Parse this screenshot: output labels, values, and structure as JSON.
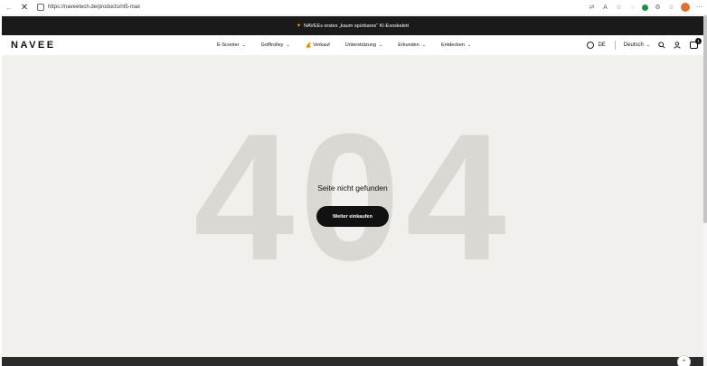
{
  "browser": {
    "url": "https://naveetech.de/products/nt5-max",
    "back_glyph": "←",
    "close_glyph": "✕",
    "icons": [
      "translate-icon",
      "read-aloud-icon",
      "favorite-icon",
      "extension-icon",
      "copilot-icon",
      "settings-icon",
      "favorites-bar-icon",
      "profile-icon",
      "more-icon"
    ]
  },
  "announcement": {
    "icon": "✦",
    "text": "NAVEEs erstes „kaum spürbares“ KI-Exoskelett"
  },
  "header": {
    "logo": "NAVEE",
    "menu": [
      {
        "label": "E-Scooter",
        "has_chevron": true
      },
      {
        "label": "Golftrolley",
        "has_chevron": true
      },
      {
        "label": "Verkauf",
        "has_chevron": false,
        "emoji": "💰"
      },
      {
        "label": "Unterstützung",
        "has_chevron": true
      },
      {
        "label": "Erkunden",
        "has_chevron": true
      },
      {
        "label": "Entdecken",
        "has_chevron": true
      }
    ],
    "region": "DE",
    "language": "Deutsch",
    "cart_count": "1"
  },
  "main": {
    "big_text": "404",
    "message": "Seite nicht gefunden",
    "cta_label": "Weiter einkaufen"
  },
  "colors": {
    "announcement_bg": "#1a1a1a",
    "page_bg": "#f1f0ed",
    "big_text": "#dad8d3",
    "button_bg": "#111111"
  }
}
